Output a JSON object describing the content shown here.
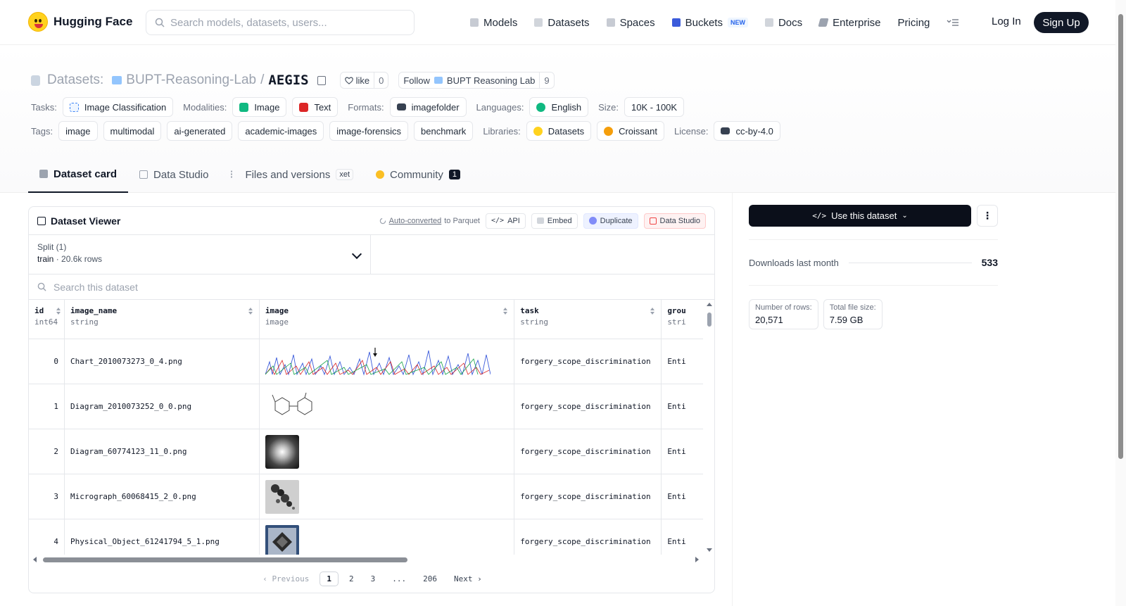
{
  "nav": {
    "brand": "Hugging Face",
    "search_placeholder": "Search models, datasets, users...",
    "links": [
      "Models",
      "Datasets",
      "Spaces",
      "Buckets",
      "Docs",
      "Enterprise",
      "Pricing"
    ],
    "buckets_badge": "NEW",
    "login": "Log In",
    "signup": "Sign Up"
  },
  "header": {
    "section": "Datasets:",
    "org": "BUPT-Reasoning-Lab",
    "separator": "/",
    "repo": "AEGIS",
    "like_label": "like",
    "like_count": "0",
    "follow_label": "Follow",
    "follow_org": "BUPT Reasoning Lab",
    "follow_count": "9"
  },
  "meta": {
    "tasks_label": "Tasks:",
    "tasks": [
      "Image Classification"
    ],
    "modalities_label": "Modalities:",
    "modalities": [
      "Image",
      "Text"
    ],
    "formats_label": "Formats:",
    "formats": [
      "imagefolder"
    ],
    "languages_label": "Languages:",
    "languages": [
      "English"
    ],
    "size_label": "Size:",
    "size": "10K - 100K",
    "tags_label": "Tags:",
    "tags": [
      "image",
      "multimodal",
      "ai-generated",
      "academic-images",
      "image-forensics",
      "benchmark"
    ],
    "libraries_label": "Libraries:",
    "libraries": [
      "Datasets",
      "Croissant"
    ],
    "license_label": "License:",
    "license": "cc-by-4.0"
  },
  "tabs": {
    "dataset_card": "Dataset card",
    "data_studio": "Data Studio",
    "files": "Files and versions",
    "xet": "xet",
    "community": "Community",
    "community_count": "1"
  },
  "viewer": {
    "title": "Dataset Viewer",
    "auto_converted": "Auto-converted",
    "to_parquet": "to Parquet",
    "api": "API",
    "embed": "Embed",
    "duplicate": "Duplicate",
    "data_studio": "Data Studio",
    "split_label": "Split (1)",
    "split_name": "train",
    "split_rows": "20.6k rows",
    "search_placeholder": "Search this dataset",
    "columns": [
      {
        "name": "id",
        "type": "int64"
      },
      {
        "name": "image_name",
        "type": "string"
      },
      {
        "name": "image",
        "type": "image"
      },
      {
        "name": "task",
        "type": "string"
      },
      {
        "name": "grou",
        "type": "stri"
      }
    ],
    "rows": [
      {
        "id": "0",
        "image_name": "Chart_2010073273_0_4.png",
        "task": "forgery_scope_discrimination",
        "group": "Enti"
      },
      {
        "id": "1",
        "image_name": "Diagram_2010073252_0_0.png",
        "task": "forgery_scope_discrimination",
        "group": "Enti"
      },
      {
        "id": "2",
        "image_name": "Diagram_60774123_11_0.png",
        "task": "forgery_scope_discrimination",
        "group": "Enti"
      },
      {
        "id": "3",
        "image_name": "Micrograph_60068415_2_0.png",
        "task": "forgery_scope_discrimination",
        "group": "Enti"
      },
      {
        "id": "4",
        "image_name": "Physical_Object_61241794_5_1.png",
        "task": "forgery_scope_discrimination",
        "group": "Enti"
      }
    ],
    "pager": {
      "prev": "Previous",
      "pages": [
        "1",
        "2",
        "3",
        "...",
        "206"
      ],
      "next": "Next"
    }
  },
  "side": {
    "use_dataset": "Use this dataset",
    "downloads_label": "Downloads last month",
    "downloads": "533",
    "rows_label": "Number of rows:",
    "rows": "20,571",
    "size_label": "Total file size:",
    "size": "7.59 GB"
  },
  "colors": {
    "dark": "#111827",
    "brand_yellow": "#ffd21e",
    "muted": "#6b7280",
    "border": "#e5e7eb"
  }
}
